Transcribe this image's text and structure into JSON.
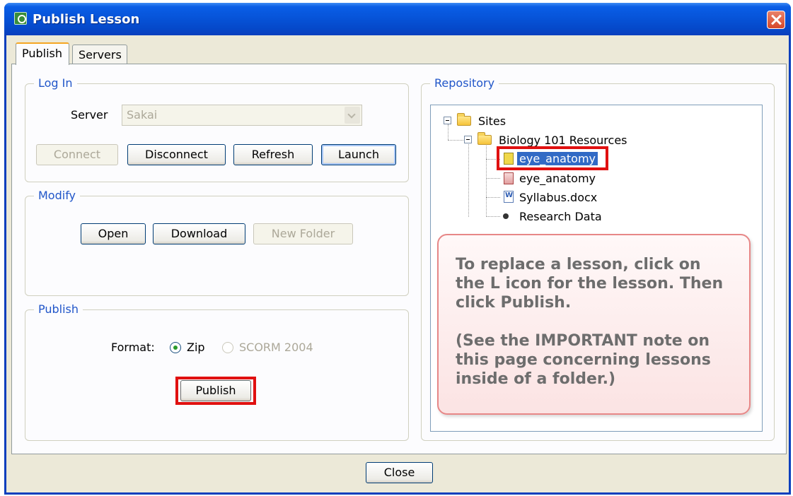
{
  "window": {
    "title": "Publish Lesson"
  },
  "tabs": [
    {
      "label": "Publish"
    },
    {
      "label": "Servers"
    }
  ],
  "login": {
    "title": "Log In",
    "server_label": "Server",
    "server_value": "Sakai",
    "buttons": {
      "connect": "Connect",
      "disconnect": "Disconnect",
      "refresh": "Refresh",
      "launch": "Launch"
    }
  },
  "modify": {
    "title": "Modify",
    "buttons": {
      "open": "Open",
      "download": "Download",
      "new_folder": "New Folder"
    }
  },
  "publish": {
    "title": "Publish",
    "format_label": "Format:",
    "options": [
      {
        "label": "Zip",
        "checked": true
      },
      {
        "label": "SCORM 2004",
        "checked": false
      }
    ],
    "button": "Publish"
  },
  "repository": {
    "title": "Repository",
    "tree": [
      {
        "label": "Sites",
        "type": "folder"
      },
      {
        "label": "Biology 101 Resources",
        "type": "folder"
      },
      {
        "label": "eye_anatomy",
        "type": "lesson",
        "selected": true
      },
      {
        "label": "eye_anatomy",
        "type": "file"
      },
      {
        "label": "Syllabus.docx",
        "type": "word"
      },
      {
        "label": "Research Data",
        "type": "item"
      }
    ]
  },
  "callout": {
    "line1": "To replace a lesson, click on the L icon for the lesson. Then click Publish.",
    "line2": "(See the IMPORTANT note on this page concerning lessons inside of a folder.)"
  },
  "footer": {
    "close": "Close"
  },
  "colors": {
    "title_bar": "#0754d9",
    "highlight": "#e01010",
    "group_title": "#2156c9"
  }
}
